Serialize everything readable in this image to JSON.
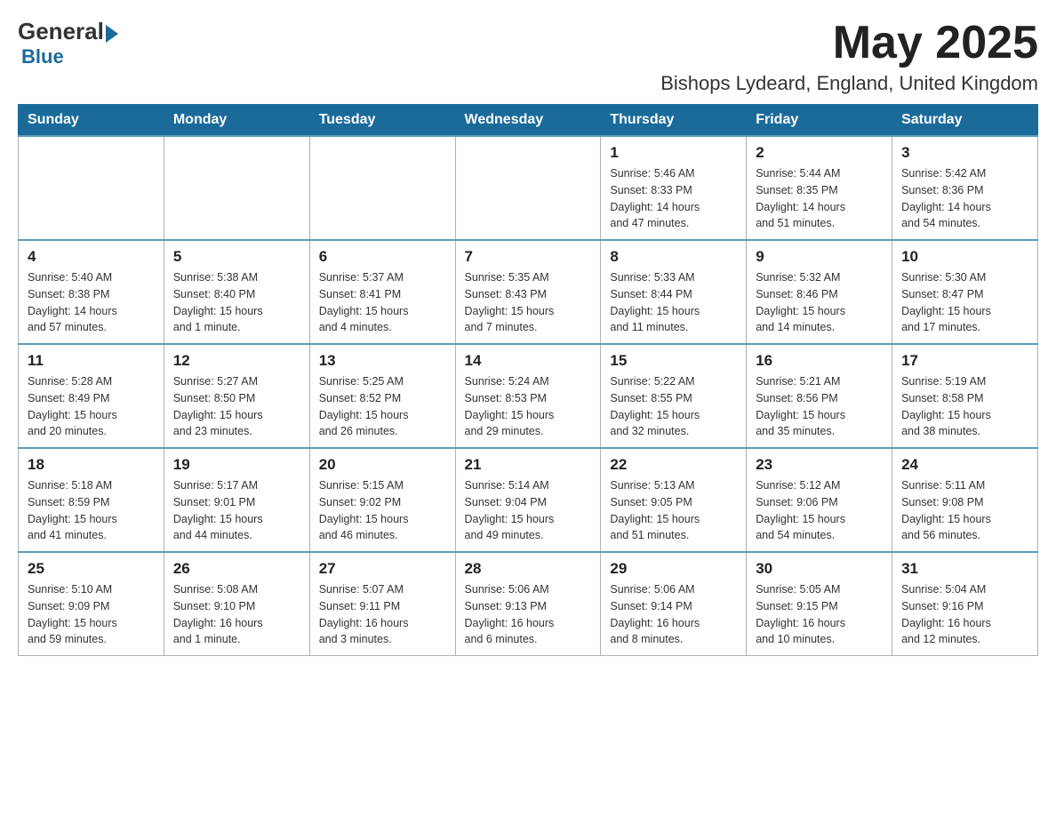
{
  "header": {
    "logo_general": "General",
    "logo_blue": "Blue",
    "month": "May 2025",
    "location": "Bishops Lydeard, England, United Kingdom"
  },
  "days_of_week": [
    "Sunday",
    "Monday",
    "Tuesday",
    "Wednesday",
    "Thursday",
    "Friday",
    "Saturday"
  ],
  "weeks": [
    [
      {
        "day": "",
        "info": ""
      },
      {
        "day": "",
        "info": ""
      },
      {
        "day": "",
        "info": ""
      },
      {
        "day": "",
        "info": ""
      },
      {
        "day": "1",
        "info": "Sunrise: 5:46 AM\nSunset: 8:33 PM\nDaylight: 14 hours\nand 47 minutes."
      },
      {
        "day": "2",
        "info": "Sunrise: 5:44 AM\nSunset: 8:35 PM\nDaylight: 14 hours\nand 51 minutes."
      },
      {
        "day": "3",
        "info": "Sunrise: 5:42 AM\nSunset: 8:36 PM\nDaylight: 14 hours\nand 54 minutes."
      }
    ],
    [
      {
        "day": "4",
        "info": "Sunrise: 5:40 AM\nSunset: 8:38 PM\nDaylight: 14 hours\nand 57 minutes."
      },
      {
        "day": "5",
        "info": "Sunrise: 5:38 AM\nSunset: 8:40 PM\nDaylight: 15 hours\nand 1 minute."
      },
      {
        "day": "6",
        "info": "Sunrise: 5:37 AM\nSunset: 8:41 PM\nDaylight: 15 hours\nand 4 minutes."
      },
      {
        "day": "7",
        "info": "Sunrise: 5:35 AM\nSunset: 8:43 PM\nDaylight: 15 hours\nand 7 minutes."
      },
      {
        "day": "8",
        "info": "Sunrise: 5:33 AM\nSunset: 8:44 PM\nDaylight: 15 hours\nand 11 minutes."
      },
      {
        "day": "9",
        "info": "Sunrise: 5:32 AM\nSunset: 8:46 PM\nDaylight: 15 hours\nand 14 minutes."
      },
      {
        "day": "10",
        "info": "Sunrise: 5:30 AM\nSunset: 8:47 PM\nDaylight: 15 hours\nand 17 minutes."
      }
    ],
    [
      {
        "day": "11",
        "info": "Sunrise: 5:28 AM\nSunset: 8:49 PM\nDaylight: 15 hours\nand 20 minutes."
      },
      {
        "day": "12",
        "info": "Sunrise: 5:27 AM\nSunset: 8:50 PM\nDaylight: 15 hours\nand 23 minutes."
      },
      {
        "day": "13",
        "info": "Sunrise: 5:25 AM\nSunset: 8:52 PM\nDaylight: 15 hours\nand 26 minutes."
      },
      {
        "day": "14",
        "info": "Sunrise: 5:24 AM\nSunset: 8:53 PM\nDaylight: 15 hours\nand 29 minutes."
      },
      {
        "day": "15",
        "info": "Sunrise: 5:22 AM\nSunset: 8:55 PM\nDaylight: 15 hours\nand 32 minutes."
      },
      {
        "day": "16",
        "info": "Sunrise: 5:21 AM\nSunset: 8:56 PM\nDaylight: 15 hours\nand 35 minutes."
      },
      {
        "day": "17",
        "info": "Sunrise: 5:19 AM\nSunset: 8:58 PM\nDaylight: 15 hours\nand 38 minutes."
      }
    ],
    [
      {
        "day": "18",
        "info": "Sunrise: 5:18 AM\nSunset: 8:59 PM\nDaylight: 15 hours\nand 41 minutes."
      },
      {
        "day": "19",
        "info": "Sunrise: 5:17 AM\nSunset: 9:01 PM\nDaylight: 15 hours\nand 44 minutes."
      },
      {
        "day": "20",
        "info": "Sunrise: 5:15 AM\nSunset: 9:02 PM\nDaylight: 15 hours\nand 46 minutes."
      },
      {
        "day": "21",
        "info": "Sunrise: 5:14 AM\nSunset: 9:04 PM\nDaylight: 15 hours\nand 49 minutes."
      },
      {
        "day": "22",
        "info": "Sunrise: 5:13 AM\nSunset: 9:05 PM\nDaylight: 15 hours\nand 51 minutes."
      },
      {
        "day": "23",
        "info": "Sunrise: 5:12 AM\nSunset: 9:06 PM\nDaylight: 15 hours\nand 54 minutes."
      },
      {
        "day": "24",
        "info": "Sunrise: 5:11 AM\nSunset: 9:08 PM\nDaylight: 15 hours\nand 56 minutes."
      }
    ],
    [
      {
        "day": "25",
        "info": "Sunrise: 5:10 AM\nSunset: 9:09 PM\nDaylight: 15 hours\nand 59 minutes."
      },
      {
        "day": "26",
        "info": "Sunrise: 5:08 AM\nSunset: 9:10 PM\nDaylight: 16 hours\nand 1 minute."
      },
      {
        "day": "27",
        "info": "Sunrise: 5:07 AM\nSunset: 9:11 PM\nDaylight: 16 hours\nand 3 minutes."
      },
      {
        "day": "28",
        "info": "Sunrise: 5:06 AM\nSunset: 9:13 PM\nDaylight: 16 hours\nand 6 minutes."
      },
      {
        "day": "29",
        "info": "Sunrise: 5:06 AM\nSunset: 9:14 PM\nDaylight: 16 hours\nand 8 minutes."
      },
      {
        "day": "30",
        "info": "Sunrise: 5:05 AM\nSunset: 9:15 PM\nDaylight: 16 hours\nand 10 minutes."
      },
      {
        "day": "31",
        "info": "Sunrise: 5:04 AM\nSunset: 9:16 PM\nDaylight: 16 hours\nand 12 minutes."
      }
    ]
  ]
}
